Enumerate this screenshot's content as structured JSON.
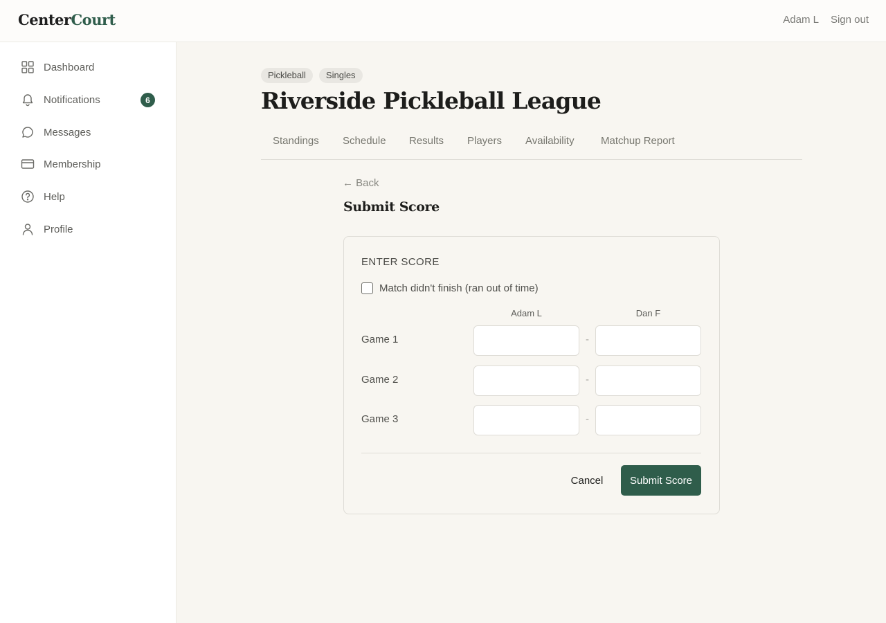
{
  "header": {
    "logo_part1": "Center",
    "logo_part2": "Court",
    "user_name": "Adam L",
    "sign_out": "Sign out"
  },
  "sidebar": {
    "items": [
      {
        "label": "Dashboard",
        "icon": "grid-icon"
      },
      {
        "label": "Notifications",
        "icon": "bell-icon",
        "badge": "6"
      },
      {
        "label": "Messages",
        "icon": "chat-bubble-icon"
      },
      {
        "label": "Membership",
        "icon": "credit-card-icon"
      },
      {
        "label": "Help",
        "icon": "question-circle-icon"
      },
      {
        "label": "Profile",
        "icon": "user-icon"
      }
    ]
  },
  "league": {
    "tags": [
      "Pickleball",
      "Singles"
    ],
    "title": "Riverside Pickleball League",
    "tabs": [
      "Standings",
      "Schedule",
      "Results",
      "Players",
      "Availability",
      "Matchup Report"
    ]
  },
  "form": {
    "back_label": "← Back",
    "title": "Submit Score",
    "section_title": "ENTER SCORE",
    "checkbox_label": "Match didn't finish (ran out of time)",
    "checkbox_checked": false,
    "player1": "Adam L",
    "player2": "Dan F",
    "separator": "-",
    "games": [
      {
        "label": "Game 1",
        "p1": "",
        "p2": ""
      },
      {
        "label": "Game 2",
        "p1": "",
        "p2": ""
      },
      {
        "label": "Game 3",
        "p1": "",
        "p2": ""
      }
    ],
    "cancel_label": "Cancel",
    "submit_label": "Submit Score"
  },
  "colors": {
    "accent": "#2f5d4b",
    "background": "#f8f6f1",
    "sidebar_bg": "#ffffff"
  }
}
